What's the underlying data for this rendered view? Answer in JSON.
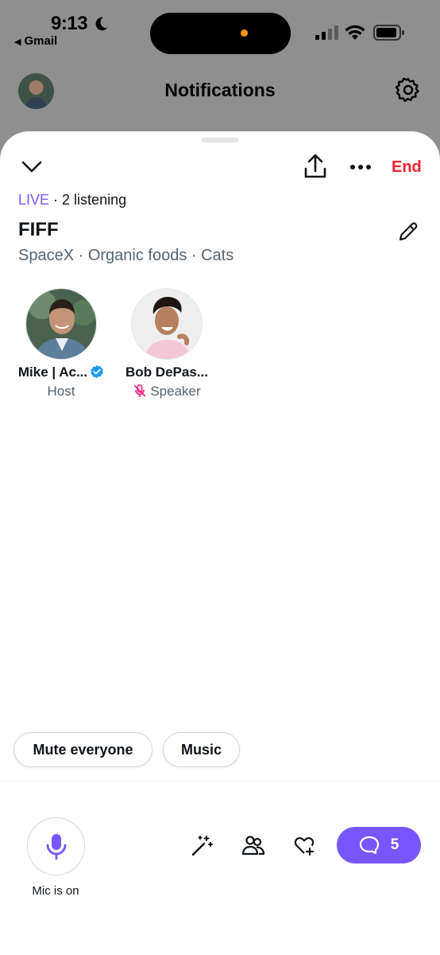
{
  "status_bar": {
    "time": "9:13",
    "back_app": "Gmail"
  },
  "header": {
    "title": "Notifications",
    "icons": [
      "avatar",
      "gear-icon"
    ]
  },
  "space": {
    "live_label": "LIVE",
    "listening": "· 2 listening",
    "end_label": "End",
    "title": "FIFF",
    "topics": "SpaceX · Organic foods · Cats",
    "participants": [
      {
        "name": "Mike | Ac...",
        "role": "Host",
        "verified": true
      },
      {
        "name": "Bob DePas...",
        "role": "Speaker",
        "muted": true
      }
    ]
  },
  "actions": {
    "mute_everyone": "Mute everyone",
    "music": "Music"
  },
  "footer": {
    "mic_label": "Mic is on",
    "comment_count": "5"
  },
  "colors": {
    "accent": "#7856ff",
    "end": "#f4212e",
    "verified": "#1d9bf0",
    "muted": "#f91880"
  }
}
